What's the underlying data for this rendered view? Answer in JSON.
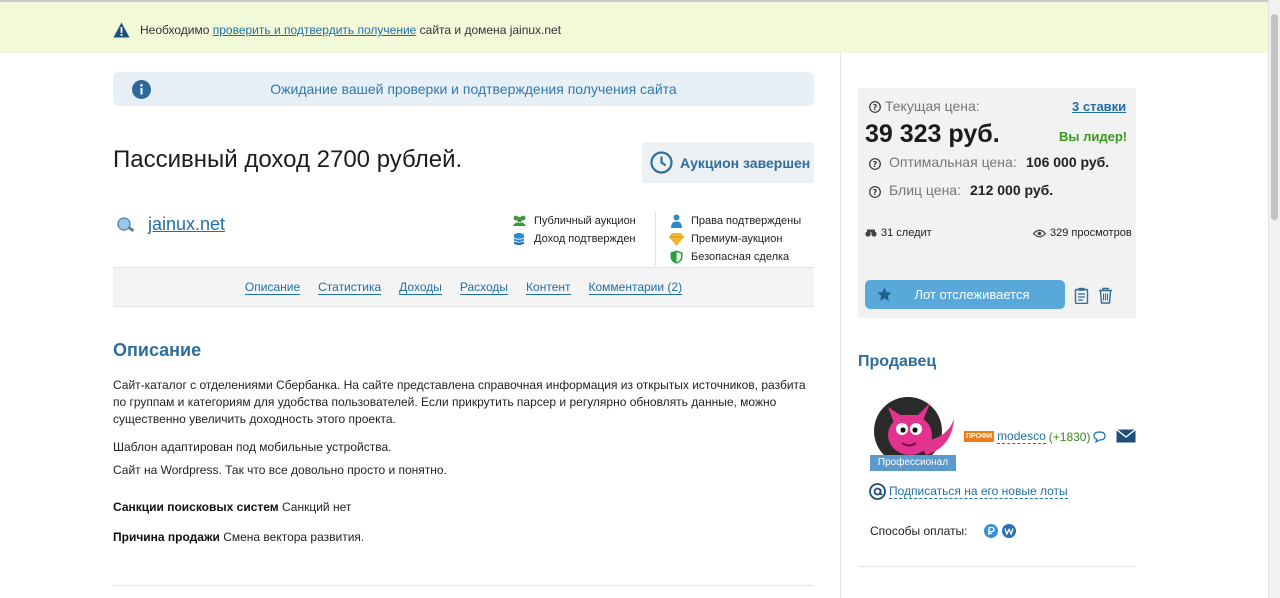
{
  "notice": {
    "prefix": "Необходимо ",
    "link": "проверить и подтвердить получение",
    "suffix": " сайта и домена jainux.net"
  },
  "banner": {
    "text": "Ожидание вашей проверки и подтверждения получения сайта"
  },
  "lot": {
    "title": "Пассивный доход 2700 рублей.",
    "state": "Аукцион завершен",
    "domain": "jainux.net"
  },
  "features": {
    "col1": [
      "Публичный аукцион",
      "Доход подтвержден"
    ],
    "col2": [
      "Права подтверждены",
      "Премиум-аукцион",
      "Безопасная сделка"
    ]
  },
  "tabs": [
    "Описание",
    "Статистика",
    "Доходы",
    "Расходы",
    "Контент",
    "Комментарии (2)"
  ],
  "description": {
    "heading": "Описание",
    "p1": "Сайт-каталог с отделениями Сбербанка. На сайте представлена справочная информация из открытых источников, разбита по группам и категориям для удобства пользователей. Если прикрутить парсер и регулярно обновлять данные, можно существенно увеличить доходность этого проекта.",
    "p2": "Шаблон адаптирован под мобильные устройства.",
    "p3": "Сайт на Wordpress. Так что все довольно просто и понятно.",
    "sanctions_label": "Санкции поисковых систем",
    "sanctions_value": " Санкций нет",
    "reason_label": "Причина продажи",
    "reason_value": " Смена вектора развития."
  },
  "price": {
    "current_label": "Текущая цена:",
    "bids": "3 ставки",
    "current_value": "39 323 руб.",
    "leader": "Вы лидер!",
    "optimal_label": "Оптимальная цена:",
    "optimal_value": "106 000 руб.",
    "blitz_label": "Блиц цена:",
    "blitz_value": "212 000 руб.",
    "followers": "31 следит",
    "views": "329 просмотров",
    "watch_button": "Лот отслеживается"
  },
  "seller": {
    "heading": "Продавец",
    "badge": "Профессионал",
    "tag": "ПРОФИ",
    "nick": "modesco",
    "rating": "(+1830)",
    "subscribe": "Подписаться на его новые лоты",
    "payment_label": "Способы оплаты:"
  },
  "colors": {
    "accent": "#2f6e9c",
    "link": "#1f6fa8",
    "notice_bg": "#f1f9d9",
    "leader": "#3a9a1f"
  }
}
